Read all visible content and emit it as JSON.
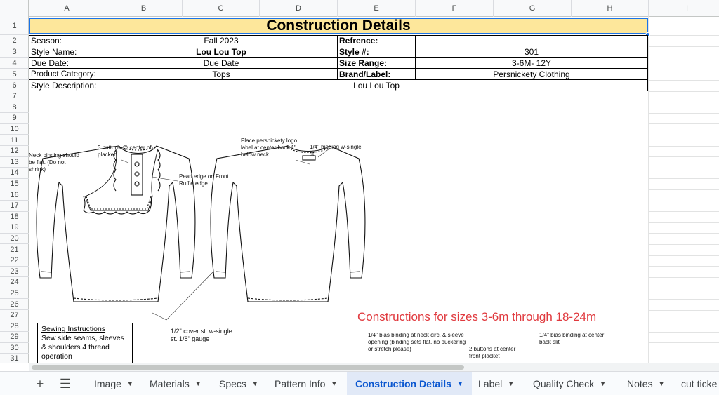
{
  "columns": [
    "A",
    "B",
    "C",
    "D",
    "E",
    "F",
    "G",
    "H",
    "I"
  ],
  "rows": [
    "1",
    "2",
    "3",
    "4",
    "5",
    "6",
    "7",
    "8",
    "9",
    "10",
    "11",
    "12",
    "13",
    "14",
    "15",
    "16",
    "17",
    "18",
    "19",
    "20",
    "21",
    "22",
    "23",
    "24",
    "25",
    "26",
    "27",
    "28",
    "29",
    "30",
    "31"
  ],
  "sheet": {
    "title": "Construction Details",
    "season_label": "Season:",
    "season_value": "Fall 2023",
    "reference_label": "Refrence:",
    "reference_value": "",
    "style_name_label": "Style Name:",
    "style_name_value": "Lou Lou Top",
    "style_no_label": "Style #:",
    "style_no_value": "301",
    "due_date_label": "Due Date:",
    "due_date_value": "Due Date",
    "size_range_label": "Size Range:",
    "size_range_value": "3-6M- 12Y",
    "product_category_label": "Product Category:",
    "product_category_value": "Tops",
    "brand_label": "Brand/Label:",
    "brand_value": "Persnickety Clothing",
    "style_desc_label": "Style Description:",
    "style_desc_value": "Lou Lou Top"
  },
  "sketch_notes": {
    "neck_binding": "Neck binding should be flat. (Do not shrink)",
    "buttons": "3 buttons @ center of placket.",
    "pearl_edge": "Pearl edge on Front Ruffle edge",
    "cover_st": "1/2\" cover st. w-single st. 1/8\" gauge",
    "logo_label": "Place persnickety logo label at center back 1\" below neck",
    "binding_back": "1/4\" binding w-single st."
  },
  "sewing_box": {
    "heading": "Sewing Instructions",
    "text": "Sew side seams, sleeves & shoulders 4 thread operation"
  },
  "constructions": {
    "heading": "Constructions for sizes 3-6m through 18-24m",
    "note1": "1/4\" bias binding at neck circ. & sleeve opening (binding sets flat, no puckering or stretch please)",
    "note2": "2 buttons at center front placket",
    "note3": "1/4\" bias binding at center back slit"
  },
  "tabs": [
    {
      "label": "Image"
    },
    {
      "label": "Materials"
    },
    {
      "label": "Specs"
    },
    {
      "label": "Pattern Info"
    },
    {
      "label": "Construction Details"
    },
    {
      "label": "Label"
    },
    {
      "label": "Quality Check"
    },
    {
      "label": "Notes"
    },
    {
      "label": "cut ticke"
    }
  ],
  "colors": {
    "title_fill": "#fde79b",
    "selection": "#1a73e8",
    "red_text": "#e0393e",
    "active_tab": "#0b57d0"
  }
}
